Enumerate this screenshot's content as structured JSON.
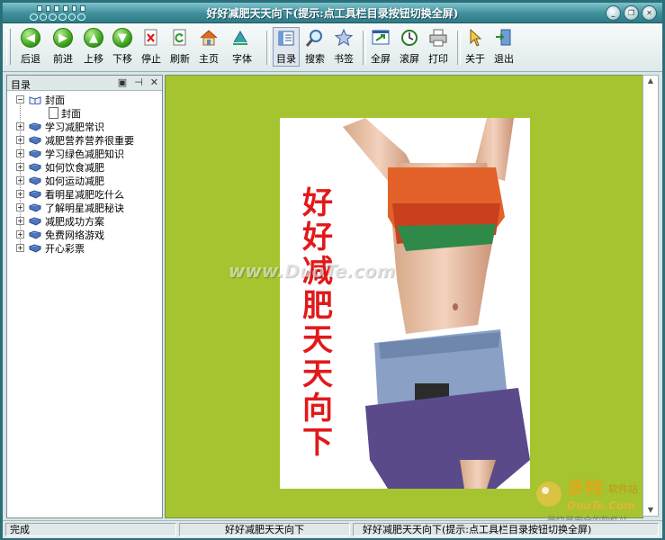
{
  "window": {
    "title": "好好减肥天天向下(提示:点工具栏目录按钮切换全屏)",
    "controls": [
      "minimize",
      "restore",
      "close"
    ]
  },
  "toolbar": {
    "buttons": [
      {
        "id": "back",
        "label": "后退",
        "icon": "left-arrow-icon"
      },
      {
        "id": "forward",
        "label": "前进",
        "icon": "right-arrow-icon"
      },
      {
        "id": "up",
        "label": "上移",
        "icon": "up-arrow-icon"
      },
      {
        "id": "down",
        "label": "下移",
        "icon": "down-arrow-icon"
      },
      {
        "id": "stop",
        "label": "停止",
        "icon": "stop-icon"
      },
      {
        "id": "refresh",
        "label": "刷新",
        "icon": "refresh-icon"
      },
      {
        "id": "home",
        "label": "主页",
        "icon": "home-icon"
      },
      {
        "id": "font",
        "label": "字体",
        "icon": "font-icon"
      },
      {
        "id": "toc",
        "label": "目录",
        "icon": "toc-icon",
        "pressed": true
      },
      {
        "id": "search",
        "label": "搜索",
        "icon": "search-icon"
      },
      {
        "id": "bookmark",
        "label": "书签",
        "icon": "star-icon"
      },
      {
        "id": "fullscreen",
        "label": "全屏",
        "icon": "fullscreen-icon"
      },
      {
        "id": "autoscroll",
        "label": "滚屏",
        "icon": "autoscroll-icon"
      },
      {
        "id": "print",
        "label": "打印",
        "icon": "printer-icon"
      },
      {
        "id": "about",
        "label": "关于",
        "icon": "pointer-icon"
      },
      {
        "id": "exit",
        "label": "退出",
        "icon": "exit-icon"
      }
    ]
  },
  "sidebar": {
    "title": "目录",
    "controls": [
      "▣",
      "⊣",
      "✕"
    ],
    "items": [
      {
        "label": "封面",
        "expanded": true,
        "children": [
          {
            "label": "封面"
          }
        ]
      },
      {
        "label": "学习减肥常识"
      },
      {
        "label": "减肥营养营养很重要"
      },
      {
        "label": "学习绿色减肥知识"
      },
      {
        "label": "如何饮食减肥"
      },
      {
        "label": "如何运动减肥"
      },
      {
        "label": "看明星减肥吃什么"
      },
      {
        "label": "了解明星减肥秘诀"
      },
      {
        "label": "减肥成功方案"
      },
      {
        "label": "免费网络游戏"
      },
      {
        "label": "开心彩票"
      }
    ],
    "expand_symbol": "+",
    "collapse_symbol": "−"
  },
  "content": {
    "cover_title_chars": [
      "好",
      "好",
      "减",
      "肥",
      "天",
      "天",
      "向",
      "下"
    ],
    "watermark": "www.DuoTe.com",
    "background_color": "#a5c430",
    "cover_title_color": "#e1191a",
    "logo": {
      "brand": "多特",
      "brand_suffix": "软件站",
      "domain": "DuoTe.Com",
      "slogan": "最快最安全的软件站"
    }
  },
  "statusbar": {
    "status": "完成",
    "page": "好好减肥天天向下",
    "hint": "好好减肥天天向下(提示:点工具栏目录按钮切换全屏)"
  }
}
